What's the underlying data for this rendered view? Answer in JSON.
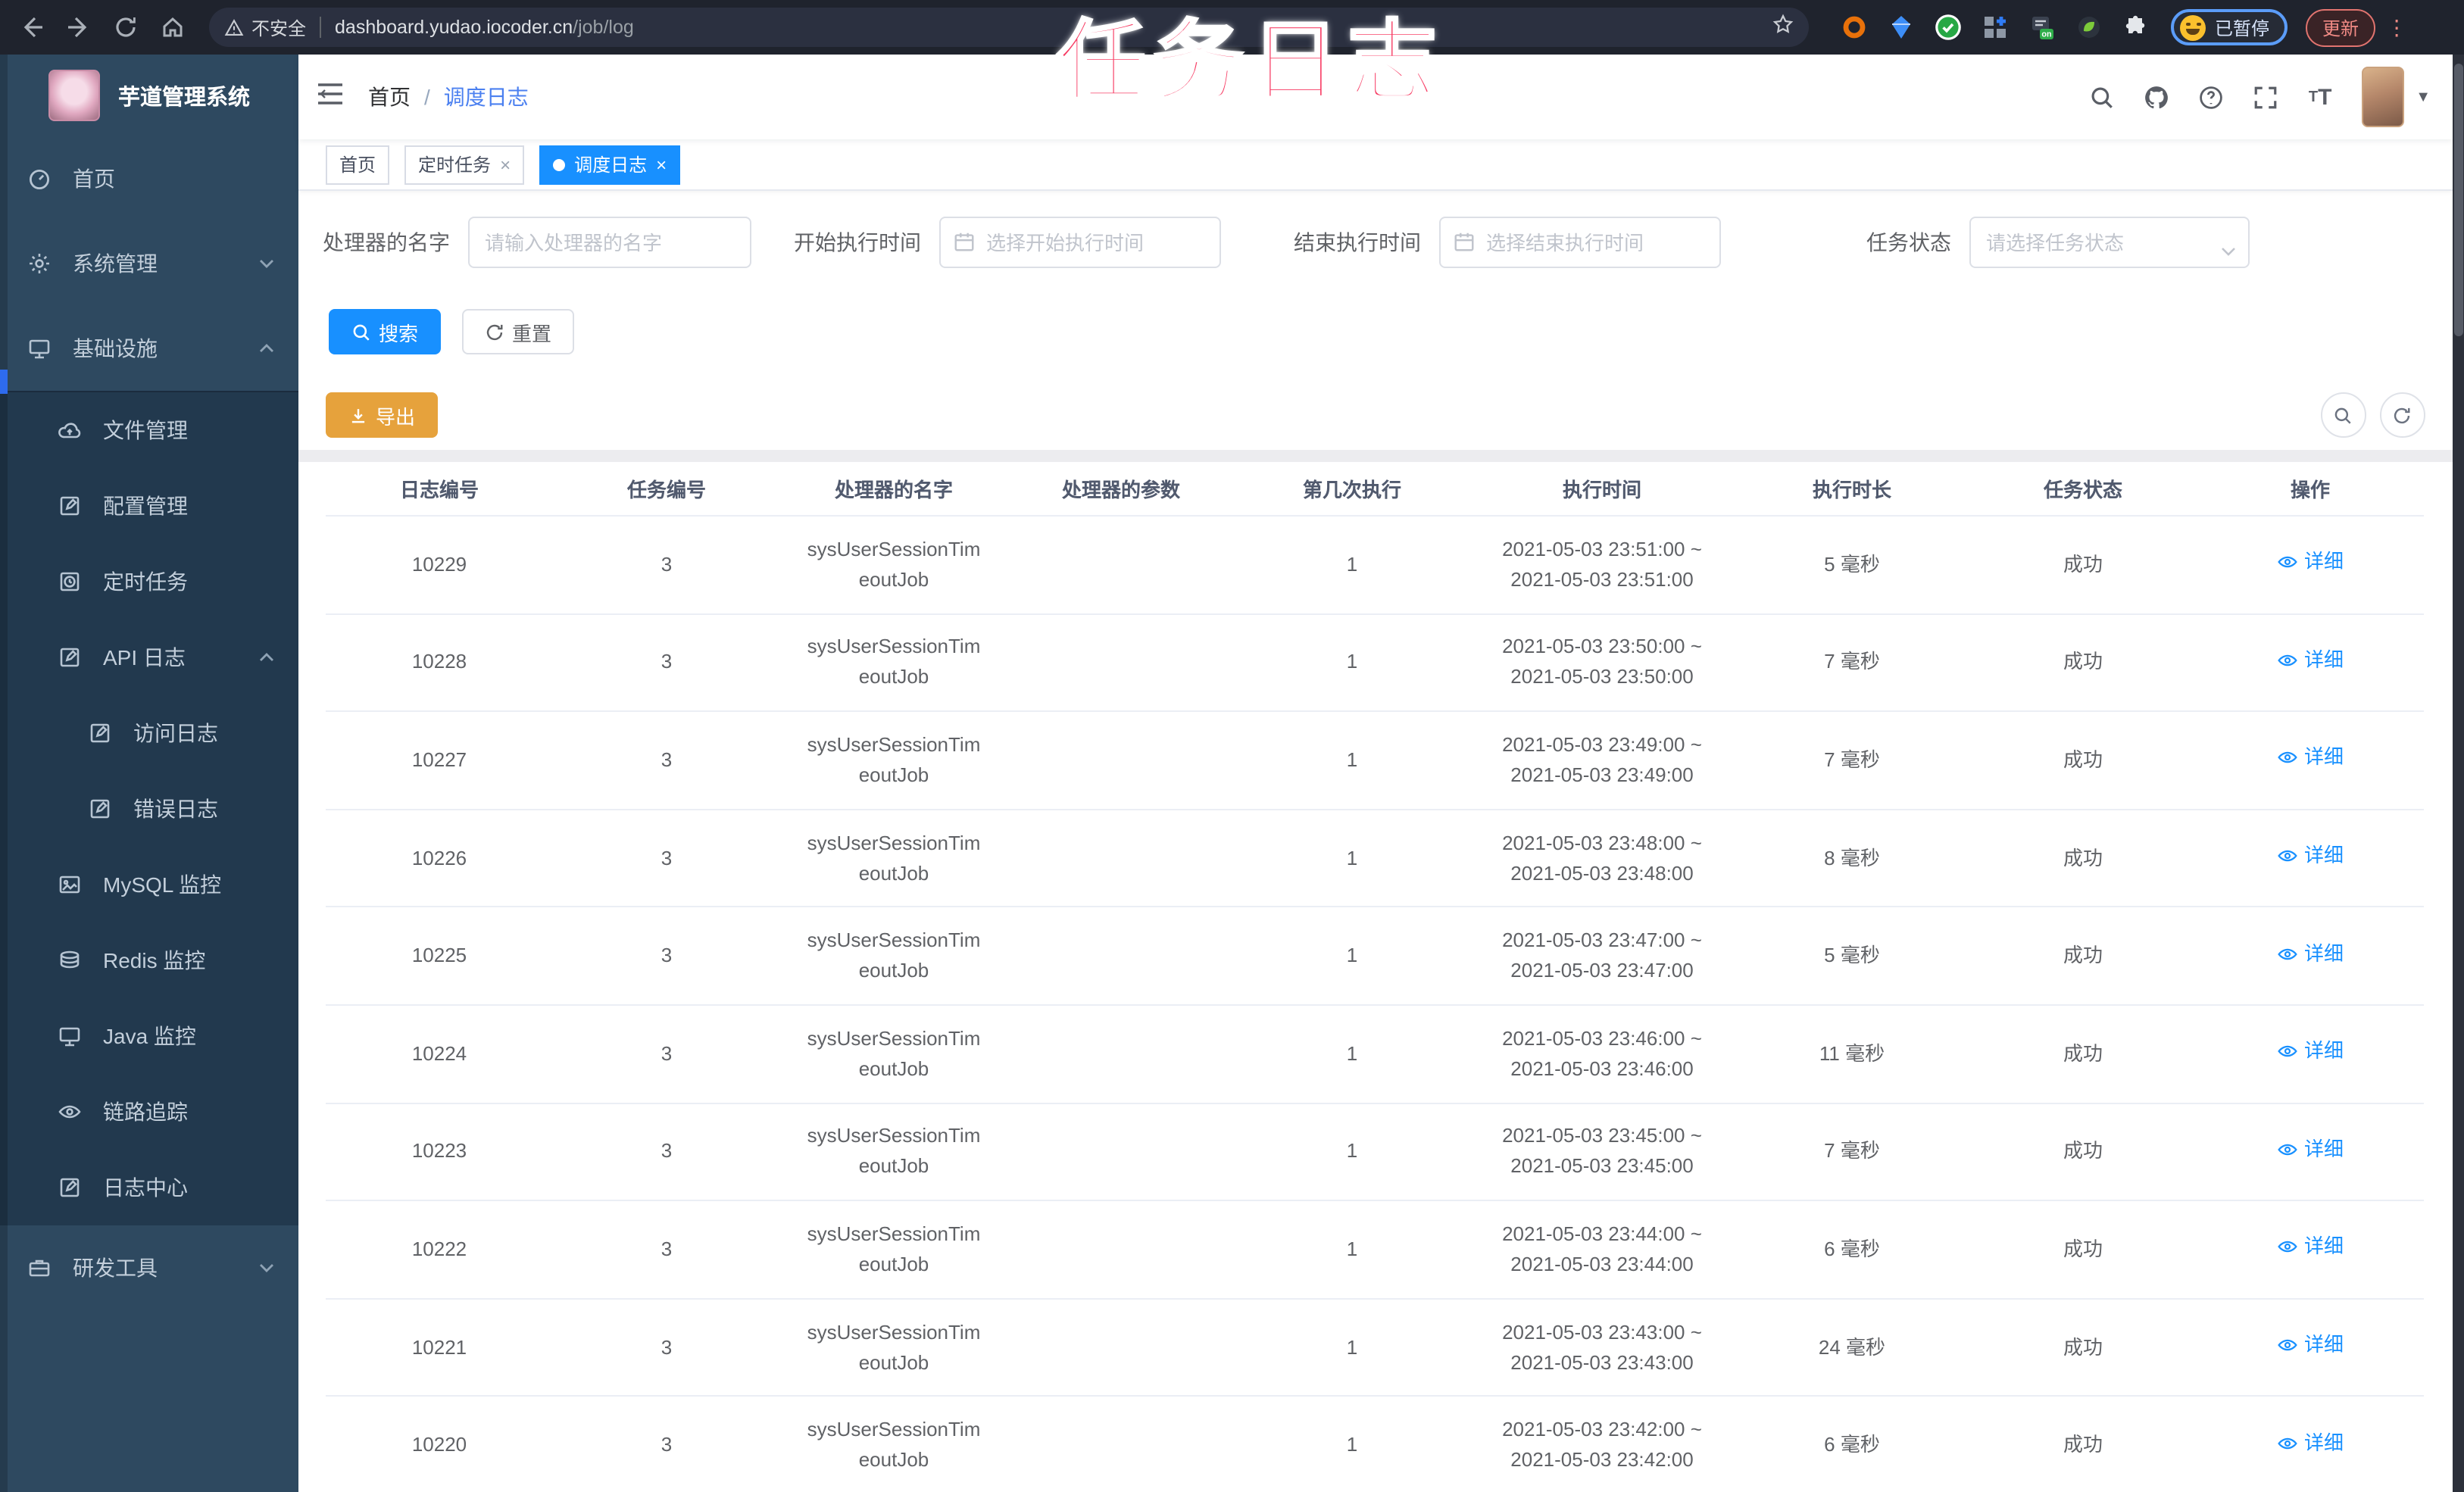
{
  "overlay": {
    "title": "任务日志"
  },
  "browser": {
    "security_label": "不安全",
    "url_host": "dashboard.yudao.iocoder.cn",
    "url_path": "/job/log",
    "paused_label": "已暂停",
    "update_label": "更新"
  },
  "sidebar": {
    "title": "芋道管理系统",
    "items": [
      {
        "label": "首页"
      },
      {
        "label": "系统管理"
      },
      {
        "label": "基础设施"
      },
      {
        "label": "文件管理"
      },
      {
        "label": "配置管理"
      },
      {
        "label": "定时任务"
      },
      {
        "label": "API 日志"
      },
      {
        "label": "访问日志"
      },
      {
        "label": "错误日志"
      },
      {
        "label": "MySQL 监控"
      },
      {
        "label": "Redis 监控"
      },
      {
        "label": "Java 监控"
      },
      {
        "label": "链路追踪"
      },
      {
        "label": "日志中心"
      },
      {
        "label": "研发工具"
      }
    ]
  },
  "breadcrumb": {
    "home": "首页",
    "separator": "/",
    "current": "调度日志"
  },
  "tags": {
    "home": "首页",
    "jobs": "定时任务",
    "joblog": "调度日志"
  },
  "filters": [
    {
      "label": "处理器的名字",
      "placeholder": "请输入处理器的名字"
    },
    {
      "label": "开始执行时间",
      "placeholder": "选择开始执行时间"
    },
    {
      "label": "结束执行时间",
      "placeholder": "选择结束执行时间"
    },
    {
      "label": "任务状态",
      "placeholder": "请选择任务状态"
    }
  ],
  "actions": {
    "search": "搜索",
    "reset": "重置",
    "export": "导出"
  },
  "table": {
    "columns": [
      "日志编号",
      "任务编号",
      "处理器的名字",
      "处理器的参数",
      "第几次执行",
      "执行时间",
      "执行时长",
      "任务状态",
      "操作"
    ],
    "rows": [
      {
        "id": "10229",
        "task": "3",
        "handler1": "sysUserSessionTim",
        "handler2": "eoutJob",
        "param": "",
        "count": "1",
        "time1": "2021-05-03 23:51:00 ~",
        "time2": "2021-05-03 23:51:00",
        "duration": "5 毫秒",
        "status": "成功",
        "action": "详细"
      },
      {
        "id": "10228",
        "task": "3",
        "handler1": "sysUserSessionTim",
        "handler2": "eoutJob",
        "param": "",
        "count": "1",
        "time1": "2021-05-03 23:50:00 ~",
        "time2": "2021-05-03 23:50:00",
        "duration": "7 毫秒",
        "status": "成功",
        "action": "详细"
      },
      {
        "id": "10227",
        "task": "3",
        "handler1": "sysUserSessionTim",
        "handler2": "eoutJob",
        "param": "",
        "count": "1",
        "time1": "2021-05-03 23:49:00 ~",
        "time2": "2021-05-03 23:49:00",
        "duration": "7 毫秒",
        "status": "成功",
        "action": "详细"
      },
      {
        "id": "10226",
        "task": "3",
        "handler1": "sysUserSessionTim",
        "handler2": "eoutJob",
        "param": "",
        "count": "1",
        "time1": "2021-05-03 23:48:00 ~",
        "time2": "2021-05-03 23:48:00",
        "duration": "8 毫秒",
        "status": "成功",
        "action": "详细"
      },
      {
        "id": "10225",
        "task": "3",
        "handler1": "sysUserSessionTim",
        "handler2": "eoutJob",
        "param": "",
        "count": "1",
        "time1": "2021-05-03 23:47:00 ~",
        "time2": "2021-05-03 23:47:00",
        "duration": "5 毫秒",
        "status": "成功",
        "action": "详细"
      },
      {
        "id": "10224",
        "task": "3",
        "handler1": "sysUserSessionTim",
        "handler2": "eoutJob",
        "param": "",
        "count": "1",
        "time1": "2021-05-03 23:46:00 ~",
        "time2": "2021-05-03 23:46:00",
        "duration": "11 毫秒",
        "status": "成功",
        "action": "详细"
      },
      {
        "id": "10223",
        "task": "3",
        "handler1": "sysUserSessionTim",
        "handler2": "eoutJob",
        "param": "",
        "count": "1",
        "time1": "2021-05-03 23:45:00 ~",
        "time2": "2021-05-03 23:45:00",
        "duration": "7 毫秒",
        "status": "成功",
        "action": "详细"
      },
      {
        "id": "10222",
        "task": "3",
        "handler1": "sysUserSessionTim",
        "handler2": "eoutJob",
        "param": "",
        "count": "1",
        "time1": "2021-05-03 23:44:00 ~",
        "time2": "2021-05-03 23:44:00",
        "duration": "6 毫秒",
        "status": "成功",
        "action": "详细"
      },
      {
        "id": "10221",
        "task": "3",
        "handler1": "sysUserSessionTim",
        "handler2": "eoutJob",
        "param": "",
        "count": "1",
        "time1": "2021-05-03 23:43:00 ~",
        "time2": "2021-05-03 23:43:00",
        "duration": "24 毫秒",
        "status": "成功",
        "action": "详细"
      },
      {
        "id": "10220",
        "task": "3",
        "handler1": "sysUserSessionTim",
        "handler2": "eoutJob",
        "param": "",
        "count": "1",
        "time1": "2021-05-03 23:42:00 ~",
        "time2": "2021-05-03 23:42:00",
        "duration": "6 毫秒",
        "status": "成功",
        "action": "详细"
      }
    ]
  }
}
